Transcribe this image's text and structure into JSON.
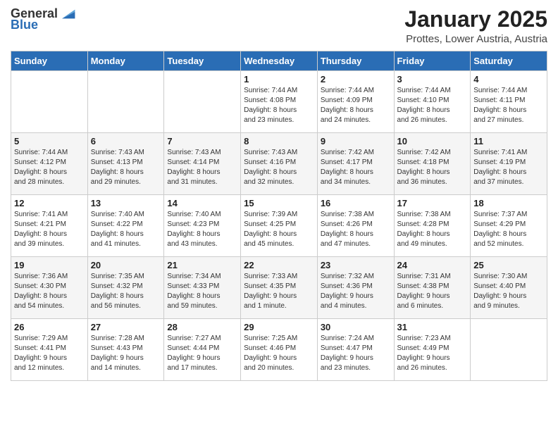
{
  "logo": {
    "general": "General",
    "blue": "Blue"
  },
  "header": {
    "month": "January 2025",
    "location": "Prottes, Lower Austria, Austria"
  },
  "weekdays": [
    "Sunday",
    "Monday",
    "Tuesday",
    "Wednesday",
    "Thursday",
    "Friday",
    "Saturday"
  ],
  "weeks": [
    [
      {
        "day": "",
        "info": ""
      },
      {
        "day": "",
        "info": ""
      },
      {
        "day": "",
        "info": ""
      },
      {
        "day": "1",
        "info": "Sunrise: 7:44 AM\nSunset: 4:08 PM\nDaylight: 8 hours\nand 23 minutes."
      },
      {
        "day": "2",
        "info": "Sunrise: 7:44 AM\nSunset: 4:09 PM\nDaylight: 8 hours\nand 24 minutes."
      },
      {
        "day": "3",
        "info": "Sunrise: 7:44 AM\nSunset: 4:10 PM\nDaylight: 8 hours\nand 26 minutes."
      },
      {
        "day": "4",
        "info": "Sunrise: 7:44 AM\nSunset: 4:11 PM\nDaylight: 8 hours\nand 27 minutes."
      }
    ],
    [
      {
        "day": "5",
        "info": "Sunrise: 7:44 AM\nSunset: 4:12 PM\nDaylight: 8 hours\nand 28 minutes."
      },
      {
        "day": "6",
        "info": "Sunrise: 7:43 AM\nSunset: 4:13 PM\nDaylight: 8 hours\nand 29 minutes."
      },
      {
        "day": "7",
        "info": "Sunrise: 7:43 AM\nSunset: 4:14 PM\nDaylight: 8 hours\nand 31 minutes."
      },
      {
        "day": "8",
        "info": "Sunrise: 7:43 AM\nSunset: 4:16 PM\nDaylight: 8 hours\nand 32 minutes."
      },
      {
        "day": "9",
        "info": "Sunrise: 7:42 AM\nSunset: 4:17 PM\nDaylight: 8 hours\nand 34 minutes."
      },
      {
        "day": "10",
        "info": "Sunrise: 7:42 AM\nSunset: 4:18 PM\nDaylight: 8 hours\nand 36 minutes."
      },
      {
        "day": "11",
        "info": "Sunrise: 7:41 AM\nSunset: 4:19 PM\nDaylight: 8 hours\nand 37 minutes."
      }
    ],
    [
      {
        "day": "12",
        "info": "Sunrise: 7:41 AM\nSunset: 4:21 PM\nDaylight: 8 hours\nand 39 minutes."
      },
      {
        "day": "13",
        "info": "Sunrise: 7:40 AM\nSunset: 4:22 PM\nDaylight: 8 hours\nand 41 minutes."
      },
      {
        "day": "14",
        "info": "Sunrise: 7:40 AM\nSunset: 4:23 PM\nDaylight: 8 hours\nand 43 minutes."
      },
      {
        "day": "15",
        "info": "Sunrise: 7:39 AM\nSunset: 4:25 PM\nDaylight: 8 hours\nand 45 minutes."
      },
      {
        "day": "16",
        "info": "Sunrise: 7:38 AM\nSunset: 4:26 PM\nDaylight: 8 hours\nand 47 minutes."
      },
      {
        "day": "17",
        "info": "Sunrise: 7:38 AM\nSunset: 4:28 PM\nDaylight: 8 hours\nand 49 minutes."
      },
      {
        "day": "18",
        "info": "Sunrise: 7:37 AM\nSunset: 4:29 PM\nDaylight: 8 hours\nand 52 minutes."
      }
    ],
    [
      {
        "day": "19",
        "info": "Sunrise: 7:36 AM\nSunset: 4:30 PM\nDaylight: 8 hours\nand 54 minutes."
      },
      {
        "day": "20",
        "info": "Sunrise: 7:35 AM\nSunset: 4:32 PM\nDaylight: 8 hours\nand 56 minutes."
      },
      {
        "day": "21",
        "info": "Sunrise: 7:34 AM\nSunset: 4:33 PM\nDaylight: 8 hours\nand 59 minutes."
      },
      {
        "day": "22",
        "info": "Sunrise: 7:33 AM\nSunset: 4:35 PM\nDaylight: 9 hours\nand 1 minute."
      },
      {
        "day": "23",
        "info": "Sunrise: 7:32 AM\nSunset: 4:36 PM\nDaylight: 9 hours\nand 4 minutes."
      },
      {
        "day": "24",
        "info": "Sunrise: 7:31 AM\nSunset: 4:38 PM\nDaylight: 9 hours\nand 6 minutes."
      },
      {
        "day": "25",
        "info": "Sunrise: 7:30 AM\nSunset: 4:40 PM\nDaylight: 9 hours\nand 9 minutes."
      }
    ],
    [
      {
        "day": "26",
        "info": "Sunrise: 7:29 AM\nSunset: 4:41 PM\nDaylight: 9 hours\nand 12 minutes."
      },
      {
        "day": "27",
        "info": "Sunrise: 7:28 AM\nSunset: 4:43 PM\nDaylight: 9 hours\nand 14 minutes."
      },
      {
        "day": "28",
        "info": "Sunrise: 7:27 AM\nSunset: 4:44 PM\nDaylight: 9 hours\nand 17 minutes."
      },
      {
        "day": "29",
        "info": "Sunrise: 7:25 AM\nSunset: 4:46 PM\nDaylight: 9 hours\nand 20 minutes."
      },
      {
        "day": "30",
        "info": "Sunrise: 7:24 AM\nSunset: 4:47 PM\nDaylight: 9 hours\nand 23 minutes."
      },
      {
        "day": "31",
        "info": "Sunrise: 7:23 AM\nSunset: 4:49 PM\nDaylight: 9 hours\nand 26 minutes."
      },
      {
        "day": "",
        "info": ""
      }
    ]
  ]
}
